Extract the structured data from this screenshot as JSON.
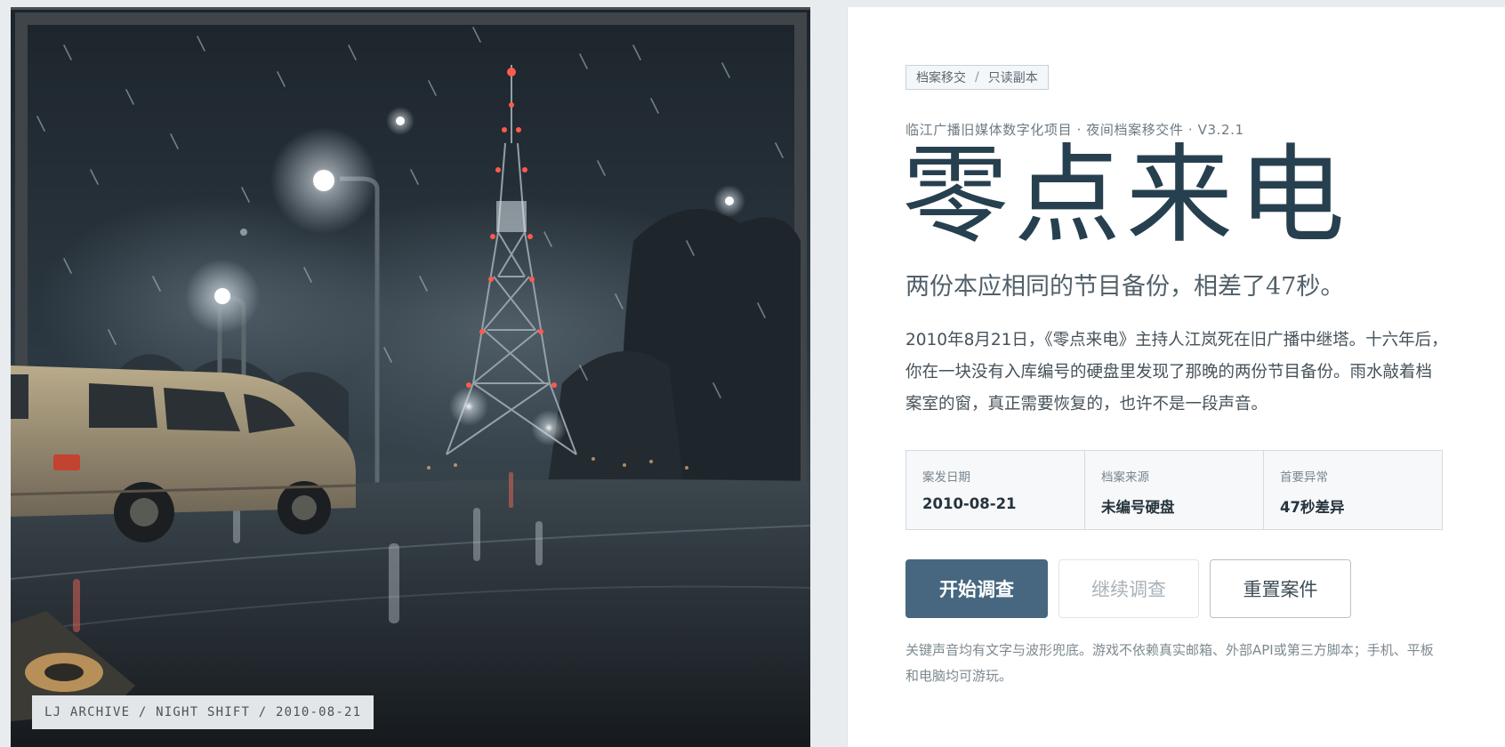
{
  "hero": {
    "caption": "LJ ARCHIVE / NIGHT SHIFT / 2010-08-21"
  },
  "breadcrumb": {
    "section": "档案移交",
    "separator": "/",
    "mode": "只读副本"
  },
  "meta_line": "临江广播旧媒体数字化项目 · 夜间档案移交件 · V3.2.1",
  "title": "零点来电",
  "subtitle": "两份本应相同的节目备份，相差了47秒。",
  "intro": "2010年8月21日，《零点来电》主持人江岚死在旧广播中继塔。十六年后，你在一块没有入库编号的硬盘里发现了那晚的两份节目备份。雨水敲着档案室的窗，真正需要恢复的，也许不是一段声音。",
  "stats": [
    {
      "label": "案发日期",
      "value": "2010-08-21"
    },
    {
      "label": "档案来源",
      "value": "未编号硬盘"
    },
    {
      "label": "首要异常",
      "value": "47秒差异"
    }
  ],
  "actions": {
    "start": "开始调查",
    "continue": "继续调查",
    "reset": "重置案件"
  },
  "footnote": "关键声音均有文字与波形兜底。游戏不依赖真实邮箱、外部API或第三方脚本；手机、平板和电脑均可游玩。",
  "colors": {
    "accent": "#46677f",
    "title": "#27404f",
    "page_background": "#e8ecef"
  }
}
